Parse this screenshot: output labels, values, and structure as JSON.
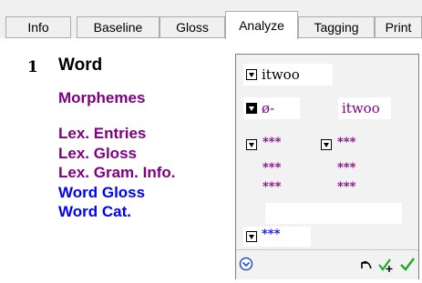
{
  "tabs": [
    {
      "label": "Info"
    },
    {
      "label": "Baseline"
    },
    {
      "label": "Gloss"
    },
    {
      "label": "Analyze"
    },
    {
      "label": "Tagging"
    },
    {
      "label": "Print"
    }
  ],
  "active_tab": "Analyze",
  "word_number": "1",
  "labels": {
    "word": "Word",
    "morphemes": "Morphemes",
    "lex_entries": "Lex. Entries",
    "lex_gloss": "Lex. Gloss",
    "lex_gram_info": "Lex. Gram. Info.",
    "word_gloss": "Word Gloss",
    "word_cat": "Word Cat."
  },
  "analysis": {
    "word_form": "itwoo",
    "morph_left": "ø-",
    "morph_right": "itwoo",
    "lex_entry_left": "***",
    "lex_entry_right": "***",
    "lex_gloss_left": "***",
    "lex_gloss_right": "***",
    "gram_info_left": "***",
    "gram_info_right": "***",
    "word_gloss": "",
    "word_cat": "***"
  },
  "colors": {
    "purple": "#800080",
    "blue": "#0000ff",
    "green_check": "#22aa22"
  },
  "icons": [
    "chevron-circle-down-icon",
    "undo-icon",
    "approve-add-icon",
    "approve-icon"
  ]
}
